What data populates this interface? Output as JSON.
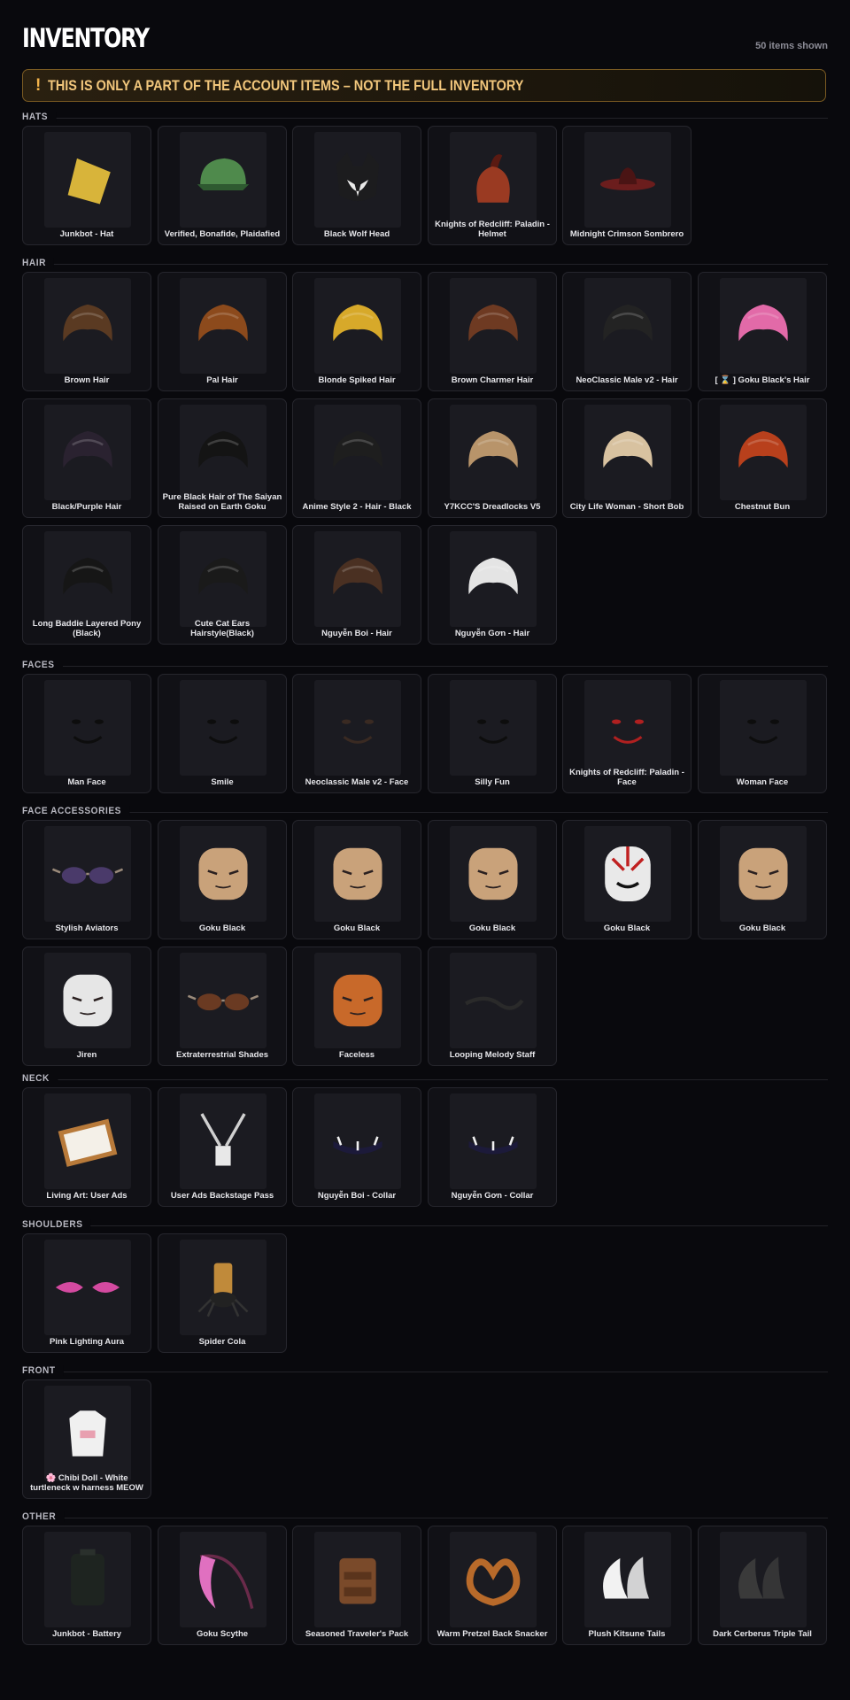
{
  "page": {
    "title": "INVENTORY",
    "count_label": "50 items shown",
    "notice": "THIS IS ONLY A PART OF THE ACCOUNT ITEMS – NOT THE FULL INVENTORY",
    "notice_icon": "!"
  },
  "sections": [
    {
      "title": "HATS",
      "items": [
        {
          "name": "Junkbot - Hat",
          "icon": "hat-icon",
          "color": "#d8b43a"
        },
        {
          "name": "Verified, Bonafide, Plaidafied",
          "icon": "cap-icon",
          "color": "#4f8a4c"
        },
        {
          "name": "Black Wolf Head",
          "icon": "wolf-head-icon",
          "color": "#1c1c1e"
        },
        {
          "name": "Knights of Redcliff: Paladin - Helmet",
          "icon": "helmet-icon",
          "color": "#9a3a22"
        },
        {
          "name": "Midnight Crimson Sombrero",
          "icon": "sombrero-icon",
          "color": "#6b1d1d"
        }
      ]
    },
    {
      "title": "HAIR",
      "items": [
        {
          "name": "Brown Hair",
          "icon": "hair-icon",
          "color": "#5a3a22"
        },
        {
          "name": "Pal Hair",
          "icon": "hair-icon",
          "color": "#8c4a1c"
        },
        {
          "name": "Blonde Spiked Hair",
          "icon": "hair-icon",
          "color": "#d7a92a"
        },
        {
          "name": "Brown Charmer Hair",
          "icon": "hair-icon",
          "color": "#6e3a22"
        },
        {
          "name": "NeoClassic Male v2 - Hair",
          "icon": "hair-icon",
          "color": "#232323"
        },
        {
          "name": "[ ⌛ ] Goku Black's Hair",
          "icon": "hair-icon",
          "color": "#e26aa8"
        },
        {
          "name": "Black/Purple Hair",
          "icon": "hair-icon",
          "color": "#2a2230"
        },
        {
          "name": "Pure Black Hair of The Saiyan Raised on Earth Goku",
          "icon": "hair-icon",
          "color": "#141414"
        },
        {
          "name": "Anime Style 2 - Hair - Black",
          "icon": "hair-icon",
          "color": "#1e1e1e"
        },
        {
          "name": "Y7KCC'S Dreadlocks V5",
          "icon": "hair-icon",
          "color": "#b8946a"
        },
        {
          "name": "City Life Woman - Short Bob",
          "icon": "hair-icon",
          "color": "#d8c2a0"
        },
        {
          "name": "Chestnut Bun",
          "icon": "hair-icon",
          "color": "#b8401c"
        },
        {
          "name": "Long Baddie Layered Pony (Black)",
          "icon": "hair-icon",
          "color": "#161616"
        },
        {
          "name": "Cute Cat Ears Hairstyle(Black)",
          "icon": "hair-icon",
          "color": "#1a1a1a"
        },
        {
          "name": "Nguyễn Boi - Hair",
          "icon": "hair-icon",
          "color": "#4a3022"
        },
        {
          "name": "Nguyễn Gơn - Hair",
          "icon": "hair-icon",
          "color": "#e4e4e4"
        }
      ]
    },
    {
      "title": "FACES",
      "items": [
        {
          "name": "Man Face",
          "icon": "face-icon",
          "color": "#0d0d0d"
        },
        {
          "name": "Smile",
          "icon": "face-icon",
          "color": "#0d0d0d"
        },
        {
          "name": "Neoclassic Male v2 - Face",
          "icon": "face-icon",
          "color": "#3a2a22"
        },
        {
          "name": "Silly Fun",
          "icon": "face-icon",
          "color": "#0d0d0d"
        },
        {
          "name": "Knights of Redcliff: Paladin - Face",
          "icon": "face-icon",
          "color": "#b02020"
        },
        {
          "name": "Woman Face",
          "icon": "face-icon",
          "color": "#0d0d0d"
        }
      ]
    },
    {
      "title": "FACE ACCESSORIES",
      "items": [
        {
          "name": "Stylish Aviators",
          "icon": "sunglasses-icon",
          "color": "#4a3a6a"
        },
        {
          "name": "Goku Black",
          "icon": "head-icon",
          "color": "#c9a27a"
        },
        {
          "name": "Goku Black",
          "icon": "head-icon",
          "color": "#c9a27a"
        },
        {
          "name": "Goku Black",
          "icon": "head-icon",
          "color": "#c9a27a"
        },
        {
          "name": "Goku Black",
          "icon": "mask-icon",
          "color": "#e9e9e9"
        },
        {
          "name": "Goku Black",
          "icon": "head-icon",
          "color": "#c9a27a"
        },
        {
          "name": "Jiren",
          "icon": "head-icon",
          "color": "#e6e6e6"
        },
        {
          "name": "Extraterrestrial Shades",
          "icon": "sunglasses-icon",
          "color": "#6a3a22"
        },
        {
          "name": "Faceless",
          "icon": "head-icon",
          "color": "#c8692a"
        },
        {
          "name": "Looping Melody Staff",
          "icon": "staff-icon",
          "color": "#2a2a2a"
        }
      ]
    },
    {
      "title": "NECK",
      "items": [
        {
          "name": "Living Art: User Ads",
          "icon": "frame-icon",
          "color": "#b87a3a"
        },
        {
          "name": "User Ads Backstage Pass",
          "icon": "lanyard-icon",
          "color": "#d0d0d0"
        },
        {
          "name": "Nguyễn Boi - Collar",
          "icon": "collar-icon",
          "color": "#1c1a3a"
        },
        {
          "name": "Nguyễn Gơn - Collar",
          "icon": "collar-icon",
          "color": "#1c1a3a"
        }
      ]
    },
    {
      "title": "SHOULDERS",
      "items": [
        {
          "name": "Pink Lighting Aura",
          "icon": "aura-icon",
          "color": "#d44aa0"
        },
        {
          "name": "Spider Cola",
          "icon": "spider-icon",
          "color": "#c08a3a"
        }
      ]
    },
    {
      "title": "FRONT",
      "items": [
        {
          "name": "🌸 Chibi Doll - White turtleneck w harness MEOW",
          "icon": "shirt-icon",
          "color": "#f0f0f0"
        }
      ]
    },
    {
      "title": "OTHER",
      "items": [
        {
          "name": "Junkbot - Battery",
          "icon": "battery-icon",
          "color": "#1e2420"
        },
        {
          "name": "Goku Scythe",
          "icon": "scythe-icon",
          "color": "#e070c0"
        },
        {
          "name": "Seasoned Traveler's Pack",
          "icon": "backpack-icon",
          "color": "#7a4a2a"
        },
        {
          "name": "Warm Pretzel Back Snacker",
          "icon": "pretzel-icon",
          "color": "#b86a2a"
        },
        {
          "name": "Plush Kitsune Tails",
          "icon": "tails-icon",
          "color": "#f2f2f2"
        },
        {
          "name": "Dark Cerberus Triple Tail",
          "icon": "tails-icon",
          "color": "#3a3a3a"
        }
      ]
    }
  ]
}
